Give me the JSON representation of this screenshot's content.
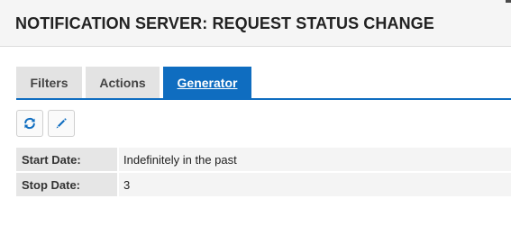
{
  "header": {
    "title": "NOTIFICATION SERVER: REQUEST STATUS CHANGE"
  },
  "tabs": [
    {
      "label": "Filters",
      "active": false
    },
    {
      "label": "Actions",
      "active": false
    },
    {
      "label": "Generator",
      "active": true
    }
  ],
  "toolbar": {
    "refresh_icon": "refresh-icon",
    "edit_icon": "pencil-icon"
  },
  "details": [
    {
      "label": "Start Date:",
      "value": "Indefinitely in the past"
    },
    {
      "label": "Stop Date:",
      "value": "3"
    }
  ],
  "colors": {
    "accent": "#0f6dc0",
    "tab_inactive": "#e3e3e3",
    "label_bg": "#e6e6e6"
  }
}
